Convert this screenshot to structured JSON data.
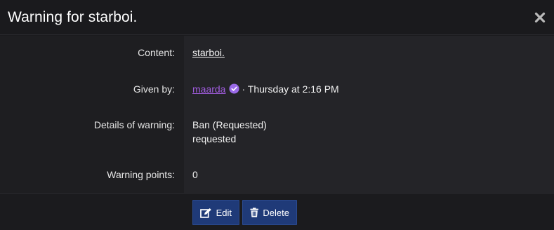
{
  "dialog": {
    "title": "Warning for starboi.",
    "close_icon": "close-icon"
  },
  "rows": {
    "content": {
      "label": "Content:",
      "value": "starboi."
    },
    "given_by": {
      "label": "Given by:",
      "user": "maarda",
      "suffix": "· Thursday at 2:16 PM"
    },
    "details": {
      "label": "Details of warning:",
      "line1": "Ban (Requested)",
      "line2": "requested"
    },
    "points": {
      "label": "Warning points:",
      "value": "0"
    }
  },
  "buttons": {
    "edit": "Edit",
    "delete": "Delete"
  },
  "colors": {
    "user_link": "#a25de0",
    "verified_badge": "#9a6ae8",
    "button_bg": "#1f3a78"
  }
}
